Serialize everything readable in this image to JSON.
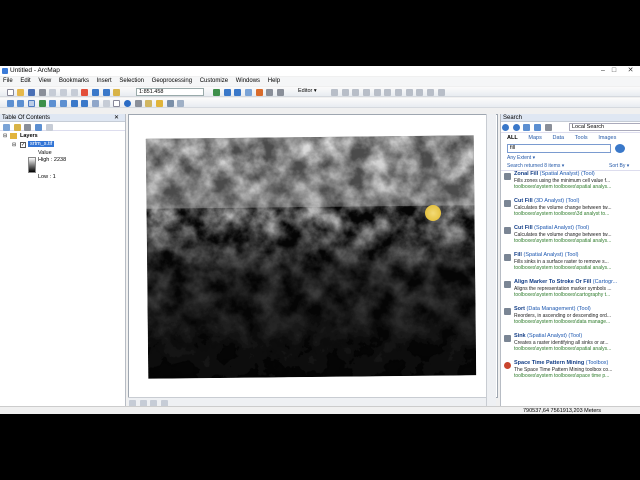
{
  "window": {
    "title": "Untitled - ArcMap"
  },
  "menu": [
    "File",
    "Edit",
    "View",
    "Bookmarks",
    "Insert",
    "Selection",
    "Geoprocessing",
    "Customize",
    "Windows",
    "Help"
  ],
  "toolbar": {
    "scale": "1:851.458",
    "editor": "Editor ▾"
  },
  "toc": {
    "title": "Table Of Contents",
    "root": "Layers",
    "layer": "srtm_s.tif",
    "value_label": "Value",
    "high": "High : 2238",
    "low": "Low : 1"
  },
  "search": {
    "title": "Search",
    "location": "Local Search",
    "tabs": [
      "ALL",
      "Maps",
      "Data",
      "Tools",
      "Images"
    ],
    "query": "fill",
    "any_extent": "Any Extent ▾",
    "returned": "Search returned 8 items ▾",
    "sort": "Sort By ▾",
    "results": [
      {
        "name": "Zonal Fill",
        "sub": " (Spatial Analyst) (Tool)",
        "desc": "Fills zones using the minimum cell value f...",
        "path": "toolboxes\\system toolboxes\\spatial analys...",
        "icon": "hammer-icon"
      },
      {
        "name": "Cut Fill",
        "sub": " (3D Analyst) (Tool)",
        "desc": "Calculates the volume change between tw...",
        "path": "toolboxes\\system toolboxes\\3d analyst to...",
        "icon": "hammer-icon"
      },
      {
        "name": "Cut Fill",
        "sub": " (Spatial Analyst) (Tool)",
        "desc": "Calculates the volume change between tw...",
        "path": "toolboxes\\system toolboxes\\spatial analys...",
        "icon": "hammer-icon"
      },
      {
        "name": "Fill",
        "sub": " (Spatial Analyst) (Tool)",
        "desc": "Fills sinks in a surface raster to remove s...",
        "path": "toolboxes\\system toolboxes\\spatial analys...",
        "icon": "hammer-icon"
      },
      {
        "name": "Align Marker To Stroke Or Fill",
        "sub": " (Cartogr...",
        "desc": "Aligns the representation marker symbols ...",
        "path": "toolboxes\\system toolboxes\\cartography t...",
        "icon": "hammer-icon"
      },
      {
        "name": "Sort",
        "sub": " (Data Management) (Tool)",
        "desc": "Reorders, in ascending or descending ord...",
        "path": "toolboxes\\system toolboxes\\data manage...",
        "icon": "hammer-icon"
      },
      {
        "name": "Sink",
        "sub": " (Spatial Analyst) (Tool)",
        "desc": "Creates a raster identifying all sinks or ar...",
        "path": "toolboxes\\system toolboxes\\spatial analys...",
        "icon": "hammer-icon"
      },
      {
        "name": "Space Time Pattern Mining",
        "sub": " (Toolbox)",
        "desc": "The Space Time Pattern Mining toolbox co...",
        "path": "toolboxes\\system toolboxes\\space time p...",
        "icon": "toolbox-icon"
      }
    ]
  },
  "status": {
    "coords": "790537,64  7561913,203 Meters"
  },
  "colors": {
    "accent": "#1c57b0",
    "path": "#2d7b2a"
  }
}
